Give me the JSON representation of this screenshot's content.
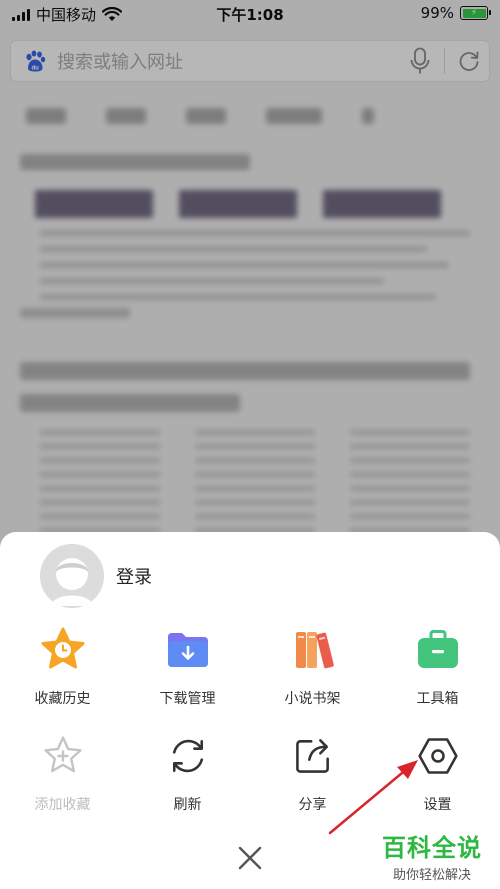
{
  "status": {
    "carrier": "中国移动",
    "time": "下午1:08",
    "battery": "99%"
  },
  "search": {
    "placeholder": "搜索或输入网址",
    "logo_icon": "baidu-paw-icon",
    "mic_icon": "microphone-icon",
    "reload_icon": "refresh-icon"
  },
  "sheet": {
    "login_label": "登录",
    "row1": [
      {
        "label": "收藏历史",
        "icon": "star-clock-icon"
      },
      {
        "label": "下载管理",
        "icon": "download-folder-icon"
      },
      {
        "label": "小说书架",
        "icon": "bookshelf-icon"
      },
      {
        "label": "工具箱",
        "icon": "toolbox-icon"
      }
    ],
    "row2": [
      {
        "label": "添加收藏",
        "icon": "add-star-icon"
      },
      {
        "label": "刷新",
        "icon": "refresh-icon"
      },
      {
        "label": "分享",
        "icon": "share-icon"
      },
      {
        "label": "设置",
        "icon": "settings-hexagon-icon"
      }
    ],
    "close_icon": "close-icon"
  },
  "watermark": {
    "title": "百科全说",
    "subtitle": "助你轻松解决"
  },
  "colors": {
    "accent_arrow": "#d9242b",
    "watermark_green": "#2eb842",
    "toolbox_green": "#43c57e",
    "download_purple": "#7b73f0"
  }
}
